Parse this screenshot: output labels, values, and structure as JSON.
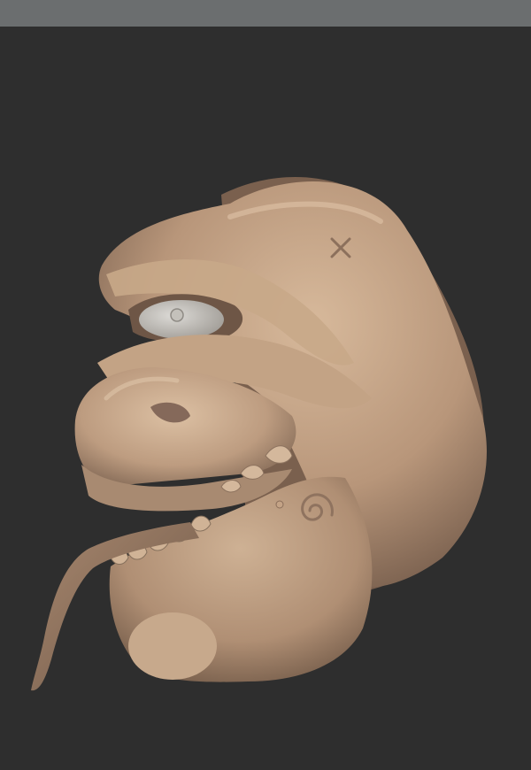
{
  "app": {
    "title": "",
    "title_bar_color": "#6b6e6f"
  },
  "viewport": {
    "background_color": "#2e2e2e",
    "model": {
      "description": "",
      "material_color": "#c9a98a",
      "shadow_color": "#7c634f"
    }
  }
}
